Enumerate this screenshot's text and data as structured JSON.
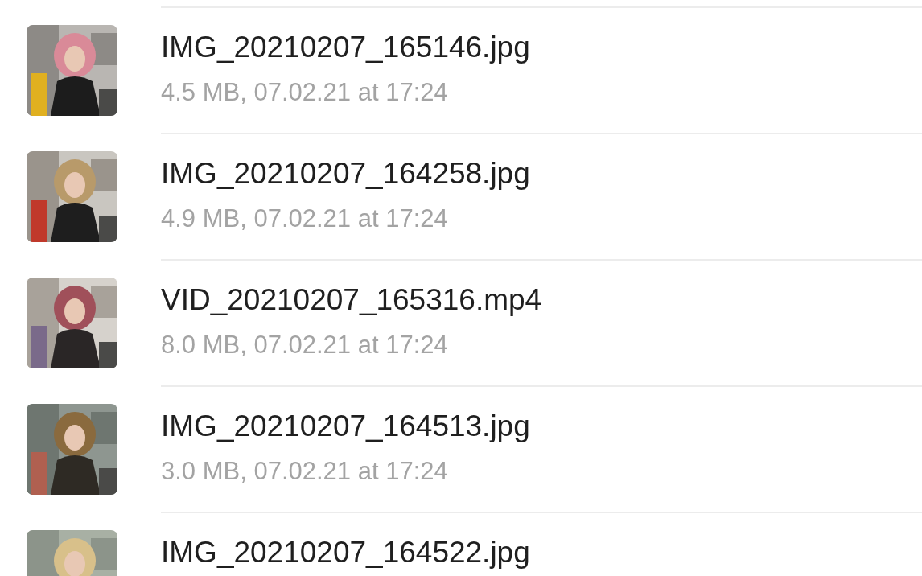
{
  "files": [
    {
      "name": "IMG_20210207_165146.jpg",
      "details": "4.5 MB, 07.02.21 at 17:24"
    },
    {
      "name": "IMG_20210207_164258.jpg",
      "details": "4.9 MB, 07.02.21 at 17:24"
    },
    {
      "name": "VID_20210207_165316.mp4",
      "details": "8.0 MB, 07.02.21 at 17:24"
    },
    {
      "name": "IMG_20210207_164513.jpg",
      "details": "3.0 MB, 07.02.21 at 17:24"
    },
    {
      "name": "IMG_20210207_164522.jpg"
    }
  ]
}
